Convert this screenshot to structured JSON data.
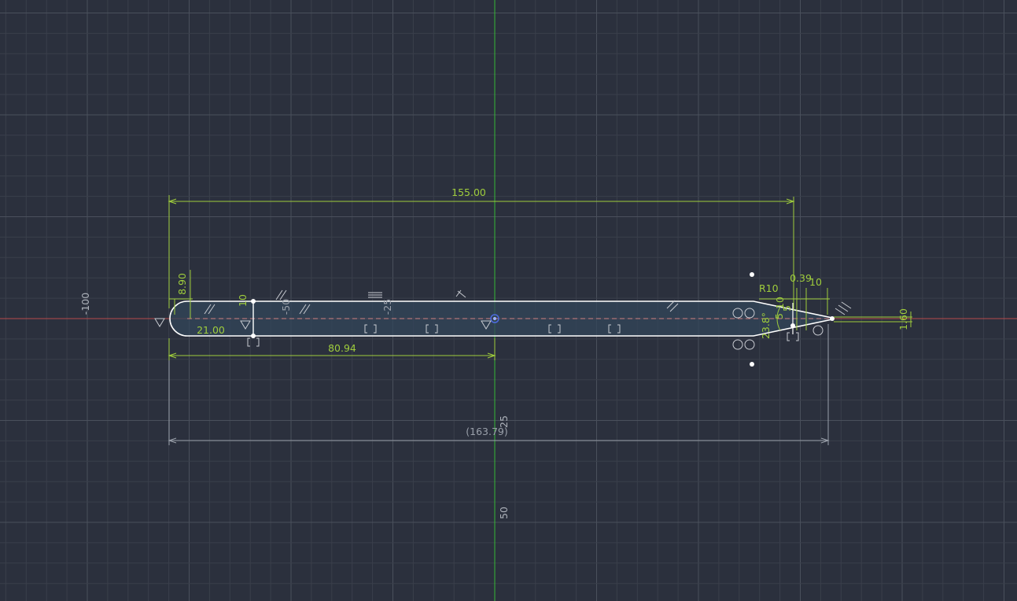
{
  "colors": {
    "background": "#2b303d",
    "grid_minor": "#3a3f4b",
    "grid_major": "#4a505c",
    "x_axis": "#b74a4a",
    "y_axis": "#35b835",
    "dimension": "#9fcd3c",
    "reference_dimension": "#9aa0aa",
    "profile": "#ffffff",
    "profile_fill": "#33465a",
    "constraint_glyph": "#c9ccd2"
  },
  "axis_labels": {
    "x_neg_100": "-100",
    "y_25": "25",
    "y_50": "50"
  },
  "dimensions": {
    "overall_length": "155.00",
    "offset_to_origin": "80.94",
    "reference_length": "(163.79)",
    "nose_height": "8.90",
    "left_offset": "21.00",
    "tip_width": "1.60",
    "tip_offset_a": "0.39",
    "tip_offset_b": "10",
    "tip_radius": "R10",
    "tip_angle": "23.8°",
    "small_a": "10",
    "small_b": "5",
    "small_c": "5"
  },
  "ruler_marks": {
    "m50": "-50",
    "m25": "-25",
    "m10": "10"
  },
  "icons": {
    "origin": "origin-point-icon",
    "coincident": "coincident-constraint-icon",
    "parallel": "parallel-constraint-icon",
    "horizontal": "horizontal-constraint-icon",
    "tangent": "tangent-constraint-icon",
    "midpoint": "midpoint-constraint-icon",
    "fix": "fix-constraint-icon"
  }
}
